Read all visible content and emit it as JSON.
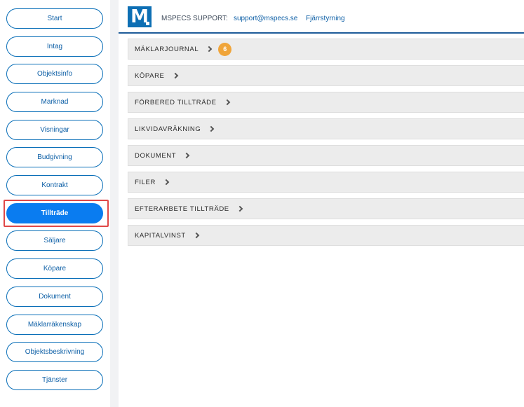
{
  "sidebar": {
    "items": [
      {
        "label": "Start"
      },
      {
        "label": "Intag"
      },
      {
        "label": "Objektsinfo"
      },
      {
        "label": "Marknad"
      },
      {
        "label": "Visningar"
      },
      {
        "label": "Budgivning"
      },
      {
        "label": "Kontrakt"
      },
      {
        "label": "Tillträde",
        "active": true
      },
      {
        "label": "Säljare"
      },
      {
        "label": "Köpare"
      },
      {
        "label": "Dokument"
      },
      {
        "label": "Mäklarräkenskap"
      },
      {
        "label": "Objektsbeskrivning"
      },
      {
        "label": "Tjänster"
      }
    ]
  },
  "header": {
    "logo_letter": "M",
    "support_label": "MSPECS SUPPORT:",
    "support_email": "support@mspecs.se",
    "remote_link": "Fjärrstyrning"
  },
  "panels": [
    {
      "label": "MÄKLARJOURNAL",
      "badge": "6"
    },
    {
      "label": "KÖPARE"
    },
    {
      "label": "FÖRBERED TILLTRÄDE"
    },
    {
      "label": "LIKVIDAVRÄKNING"
    },
    {
      "label": "DOKUMENT"
    },
    {
      "label": "FILER"
    },
    {
      "label": "EFTERARBETE TILLTRÄDE"
    },
    {
      "label": "KAPITALVINST"
    }
  ],
  "colors": {
    "accent": "#0a7cf0",
    "brand": "#0d6fb4",
    "badge": "#f0a53a",
    "highlight_frame": "#e04848"
  }
}
